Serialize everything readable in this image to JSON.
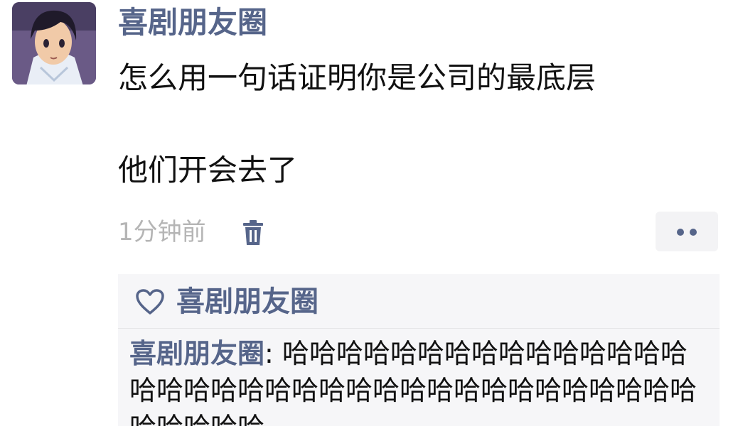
{
  "post": {
    "author": "喜剧朋友圈",
    "text_line1": "怎么用一句话证明你是公司的最底层",
    "text_line2": "他们开会去了",
    "timestamp": "1分钟前"
  },
  "icons": {
    "delete": "trash-icon",
    "more": "more-dots-icon",
    "like": "heart-icon"
  },
  "likes": {
    "names": "喜剧朋友圈"
  },
  "comment": {
    "author": "喜剧朋友圈",
    "separator": ": ",
    "text": "哈哈哈哈哈哈哈哈哈哈哈哈哈哈哈哈哈哈哈哈哈哈哈哈哈哈哈哈哈哈哈哈哈哈哈哈哈哈哈哈哈"
  },
  "colors": {
    "link_blue": "#56658a",
    "timestamp_gray": "#b5b5b5",
    "comment_bg": "#f6f6f8"
  }
}
